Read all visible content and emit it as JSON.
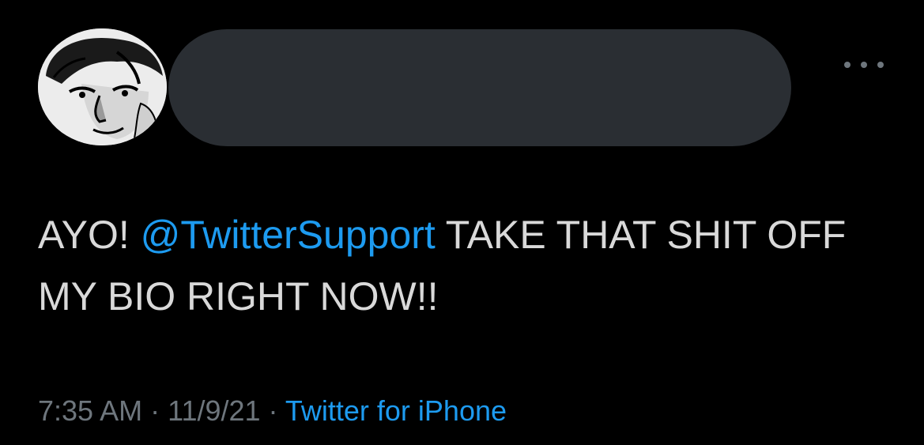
{
  "author": {
    "avatar_icon": "manga-portrait-avatar",
    "name_redacted": true
  },
  "menu": {
    "icon": "more-options-icon"
  },
  "tweet": {
    "text_prefix": "AYO! ",
    "mention": "@TwitterSupport",
    "text_suffix": " TAKE THAT SHIT OFF MY BIO RIGHT NOW!!"
  },
  "meta": {
    "time": "7:35 AM",
    "separator_1": " · ",
    "date": "11/9/21",
    "separator_2": " · ",
    "source": "Twitter for iPhone"
  },
  "colors": {
    "background": "#000000",
    "text": "#d9d9d9",
    "muted": "#6e767d",
    "link": "#1d9bf0",
    "redaction": "#2a2e33"
  }
}
